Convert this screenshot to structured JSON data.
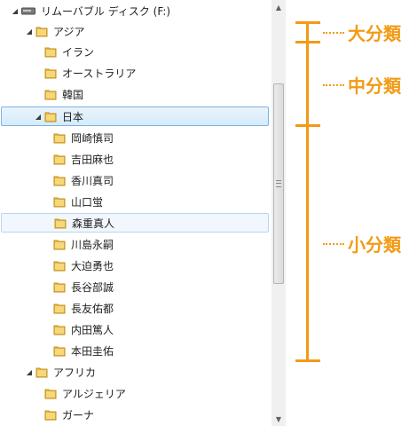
{
  "tree": {
    "drive": {
      "label": "リムーバブル ディスク (F:)",
      "expanded": true
    },
    "continents": [
      {
        "label": "アジア",
        "expanded": true,
        "countries": [
          {
            "label": "イラン"
          },
          {
            "label": "オーストラリア"
          },
          {
            "label": "韓国"
          },
          {
            "label": "日本",
            "expanded": true,
            "selected": true,
            "people": [
              "岡崎慎司",
              "吉田麻也",
              "香川真司",
              "山口蛍",
              "森重真人",
              "川島永嗣",
              "大迫勇也",
              "長谷部誠",
              "長友佑都",
              "内田篤人",
              "本田圭佑"
            ]
          }
        ]
      },
      {
        "label": "アフリカ",
        "expanded": true,
        "countries": [
          {
            "label": "アルジェリア"
          },
          {
            "label": "ガーナ"
          }
        ]
      }
    ],
    "hover_item": "森重真人"
  },
  "annotations": {
    "large": "大分類",
    "medium": "中分類",
    "small": "小分類",
    "color": "#f39a16"
  },
  "icons": {
    "folder": "folder-icon",
    "drive": "drive-icon",
    "expanded": "expanded-arrow-icon"
  }
}
